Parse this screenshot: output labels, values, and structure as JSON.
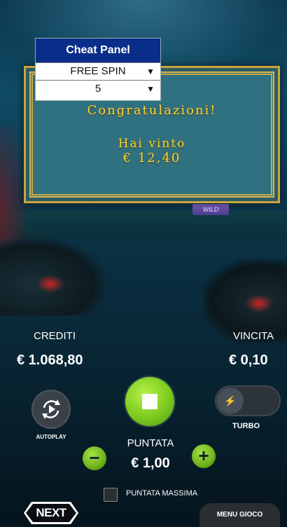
{
  "cheat_panel": {
    "title": "Cheat Panel",
    "mode_select": "FREE SPIN",
    "count_select": "5"
  },
  "win_dialog": {
    "title": "Congratulazioni!",
    "subtitle": "Hai vinto",
    "amount": "€ 12,40"
  },
  "reel_symbol": "WILD",
  "stats": {
    "credits_label": "CREDITI",
    "credits_value": "€ 1.068,80",
    "win_label": "VINCITA",
    "win_value": "€ 0,10"
  },
  "controls": {
    "autoplay_label": "AUTOPLAY",
    "turbo_label": "TURBO",
    "bet_label": "PUNTATA",
    "bet_value": "€ 1,00",
    "minus": "−",
    "plus": "+",
    "max_bet_label": "PUNTATA MASSIMA",
    "menu_label": "MENU GIOCO",
    "brand_logo": "NEXT"
  },
  "colors": {
    "accent_green": "#7ccb1f",
    "cheat_header": "#0a2d8a",
    "dialog_gold": "#f7d438",
    "dialog_bg": "#2f7081"
  }
}
